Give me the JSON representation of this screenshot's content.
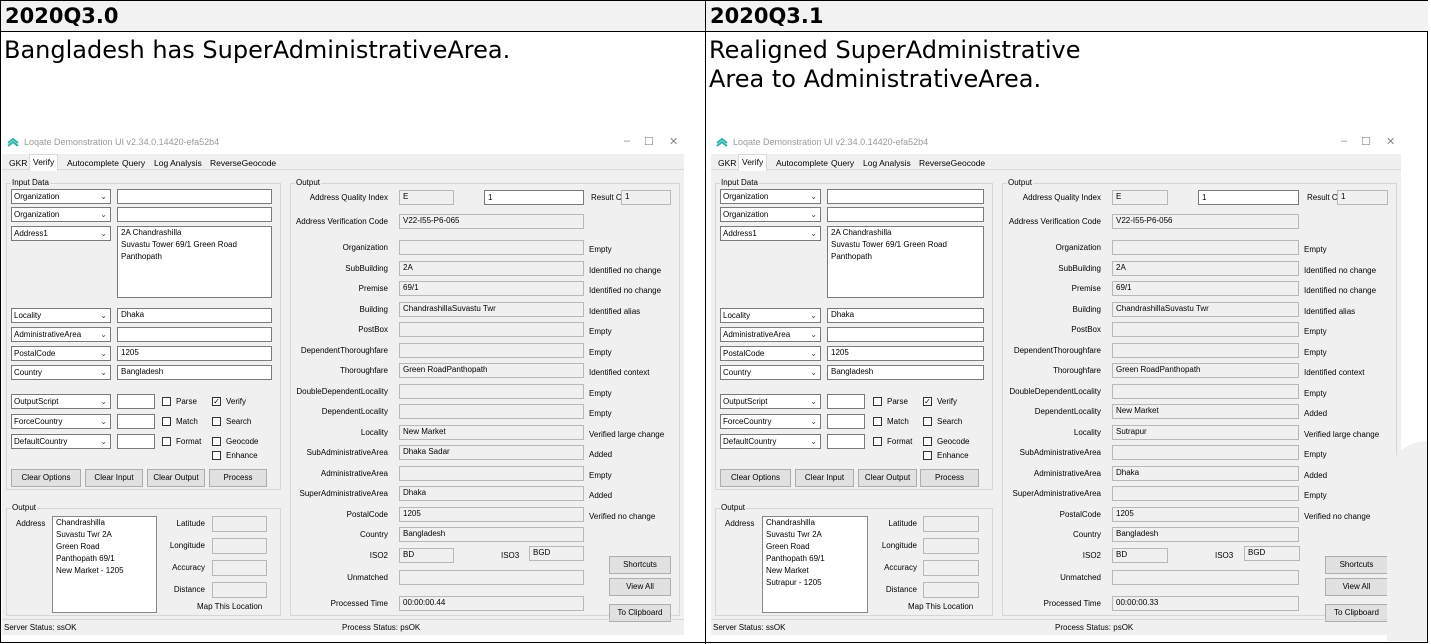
{
  "headers": [
    "2020Q3.0",
    "2020Q3.1"
  ],
  "descriptions": [
    "Bangladesh has SuperAdministrativeArea.",
    "Realigned SuperAdministrative Area to AdministrativeArea."
  ],
  "windows": [
    {
      "title": "Loqate Demonstration UI v2.34.0.14420-efa52b4",
      "tabs": [
        "GKR",
        "Verify",
        "Autocomplete",
        "Query",
        "Log Analysis",
        "ReverseGeocode"
      ],
      "input_group": "Input Data",
      "inputs": [
        {
          "combo": "Organization",
          "value": ""
        },
        {
          "combo": "Organization",
          "value": ""
        },
        {
          "combo": "Address1",
          "value": "2A Chandrashilla\nSuvastu Tower 69/1 Green Road\nPanthopath"
        },
        {
          "combo": "Locality",
          "value": "Dhaka"
        },
        {
          "combo": "AdministrativeArea",
          "value": ""
        },
        {
          "combo": "PostalCode",
          "value": "1205"
        },
        {
          "combo": "Country",
          "value": "Bangladesh"
        }
      ],
      "options": [
        {
          "combo": "OutputScript"
        },
        {
          "combo": "ForceCountry"
        },
        {
          "combo": "DefaultCountry"
        }
      ],
      "checks": [
        {
          "label": "Parse",
          "checked": false
        },
        {
          "label": "Verify",
          "checked": true
        },
        {
          "label": "Match",
          "checked": false
        },
        {
          "label": "Search",
          "checked": false
        },
        {
          "label": "Format",
          "checked": false
        },
        {
          "label": "Geocode",
          "checked": false
        },
        {
          "label": "Enhance",
          "checked": false
        }
      ],
      "buttons": [
        "Clear Options",
        "Clear Input",
        "Clear Output",
        "Process"
      ],
      "output_group": "Output",
      "address_label": "Address",
      "address_output": "Chandrashilla\nSuvastu Twr 2A\nGreen Road\nPanthopath 69/1\nNew Market - 1205",
      "geo_labels": [
        "Latitude",
        "Longitude",
        "Accuracy",
        "Distance"
      ],
      "map_link": "Map This Location",
      "aqi_label": "Address Quality Index",
      "aqi": "E",
      "count": "1",
      "result_count_label": "Result Count",
      "result_count": "1",
      "avc_label": "Address Verification Code",
      "avc": "V22-I55-P6-065",
      "fields": [
        {
          "label": "Organization",
          "value": "",
          "status": "Empty"
        },
        {
          "label": "SubBuilding",
          "value": "2A",
          "status": "Identified no change"
        },
        {
          "label": "Premise",
          "value": "69/1",
          "status": "Identified no change"
        },
        {
          "label": "Building",
          "value": "ChandrashillaSuvastu Twr",
          "status": "Identified alias"
        },
        {
          "label": "PostBox",
          "value": "",
          "status": "Empty"
        },
        {
          "label": "DependentThoroughfare",
          "value": "",
          "status": "Empty"
        },
        {
          "label": "Thoroughfare",
          "value": "Green RoadPanthopath",
          "status": "Identified context"
        },
        {
          "label": "DoubleDependentLocality",
          "value": "",
          "status": "Empty"
        },
        {
          "label": "DependentLocality",
          "value": "",
          "status": "Empty"
        },
        {
          "label": "Locality",
          "value": "New Market",
          "status": "Verified large change"
        },
        {
          "label": "SubAdministrativeArea",
          "value": "Dhaka Sadar",
          "status": "Added"
        },
        {
          "label": "AdministrativeArea",
          "value": "",
          "status": "Empty"
        },
        {
          "label": "SuperAdministrativeArea",
          "value": "Dhaka",
          "status": "Added"
        },
        {
          "label": "PostalCode",
          "value": "1205",
          "status": "Verified no change"
        },
        {
          "label": "Country",
          "value": "Bangladesh",
          "status": ""
        }
      ],
      "iso2_label": "ISO2",
      "iso2": "BD",
      "iso3_label": "ISO3",
      "iso3": "BGD",
      "unmatched_label": "Unmatched",
      "processed_label": "Processed Time",
      "processed": "00:00:00.44",
      "side_buttons": [
        "Shortcuts",
        "View All",
        "To Clipboard"
      ],
      "server_status": "Server Status: ssOK",
      "process_status": "Process Status: psOK"
    },
    {
      "title": "Loqate Demonstration UI v2.34.0.14420-efa52b4",
      "tabs": [
        "GKR",
        "Verify",
        "Autocomplete",
        "Query",
        "Log Analysis",
        "ReverseGeocode"
      ],
      "input_group": "Input Data",
      "inputs": [
        {
          "combo": "Organization",
          "value": ""
        },
        {
          "combo": "Organization",
          "value": ""
        },
        {
          "combo": "Address1",
          "value": "2A Chandrashilla\nSuvastu Tower 69/1 Green Road\nPanthopath"
        },
        {
          "combo": "Locality",
          "value": "Dhaka"
        },
        {
          "combo": "AdministrativeArea",
          "value": ""
        },
        {
          "combo": "PostalCode",
          "value": "1205"
        },
        {
          "combo": "Country",
          "value": "Bangladesh"
        }
      ],
      "options": [
        {
          "combo": "OutputScript"
        },
        {
          "combo": "ForceCountry"
        },
        {
          "combo": "DefaultCountry"
        }
      ],
      "checks": [
        {
          "label": "Parse",
          "checked": false
        },
        {
          "label": "Verify",
          "checked": true
        },
        {
          "label": "Match",
          "checked": false
        },
        {
          "label": "Search",
          "checked": false
        },
        {
          "label": "Format",
          "checked": false
        },
        {
          "label": "Geocode",
          "checked": false
        },
        {
          "label": "Enhance",
          "checked": false
        }
      ],
      "buttons": [
        "Clear Options",
        "Clear Input",
        "Clear Output",
        "Process"
      ],
      "output_group": "Output",
      "address_label": "Address",
      "address_output": "Chandrashilla\nSuvastu Twr 2A\nGreen Road\nPanthopath 69/1\nNew Market\nSutrapur - 1205",
      "geo_labels": [
        "Latitude",
        "Longitude",
        "Accuracy",
        "Distance"
      ],
      "map_link": "Map This Location",
      "aqi_label": "Address Quality Index",
      "aqi": "E",
      "count": "1",
      "result_count_label": "Result Count",
      "result_count": "1",
      "avc_label": "Address Verification Code",
      "avc": "V22-I55-P6-056",
      "fields": [
        {
          "label": "Organization",
          "value": "",
          "status": "Empty"
        },
        {
          "label": "SubBuilding",
          "value": "2A",
          "status": "Identified no change"
        },
        {
          "label": "Premise",
          "value": "69/1",
          "status": "Identified no change"
        },
        {
          "label": "Building",
          "value": "ChandrashillaSuvastu Twr",
          "status": "Identified alias"
        },
        {
          "label": "PostBox",
          "value": "",
          "status": "Empty"
        },
        {
          "label": "DependentThoroughfare",
          "value": "",
          "status": "Empty"
        },
        {
          "label": "Thoroughfare",
          "value": "Green RoadPanthopath",
          "status": "Identified context"
        },
        {
          "label": "DoubleDependentLocality",
          "value": "",
          "status": "Empty"
        },
        {
          "label": "DependentLocality",
          "value": "New Market",
          "status": "Added"
        },
        {
          "label": "Locality",
          "value": "Sutrapur",
          "status": "Verified large change"
        },
        {
          "label": "SubAdministrativeArea",
          "value": "",
          "status": "Empty"
        },
        {
          "label": "AdministrativeArea",
          "value": "Dhaka",
          "status": "Added"
        },
        {
          "label": "SuperAdministrativeArea",
          "value": "",
          "status": "Empty"
        },
        {
          "label": "PostalCode",
          "value": "1205",
          "status": "Verified no change"
        },
        {
          "label": "Country",
          "value": "Bangladesh",
          "status": ""
        }
      ],
      "iso2_label": "ISO2",
      "iso2": "BD",
      "iso3_label": "ISO3",
      "iso3": "BGD",
      "unmatched_label": "Unmatched",
      "processed_label": "Processed Time",
      "processed": "00:00:00.33",
      "side_buttons": [
        "Shortcuts",
        "View All",
        "To Clipboard"
      ],
      "server_status": "Server Status: ssOK",
      "process_status": "Process Status: psOK"
    }
  ]
}
